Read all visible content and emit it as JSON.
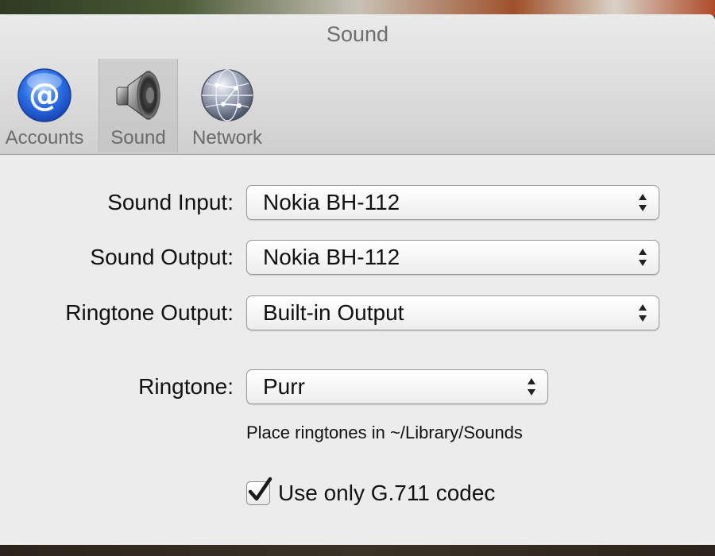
{
  "window": {
    "title": "Sound"
  },
  "toolbar": {
    "items": [
      {
        "label": "Accounts",
        "icon": "at-sign-icon",
        "selected": false
      },
      {
        "label": "Sound",
        "icon": "speaker-icon",
        "selected": true
      },
      {
        "label": "Network",
        "icon": "globe-icon",
        "selected": false
      }
    ]
  },
  "form": {
    "sound_input": {
      "label": "Sound Input:",
      "value": "Nokia BH-112"
    },
    "sound_output": {
      "label": "Sound Output:",
      "value": "Nokia BH-112"
    },
    "ringtone_output": {
      "label": "Ringtone Output:",
      "value": "Built-in Output"
    },
    "ringtone": {
      "label": "Ringtone:",
      "value": "Purr"
    },
    "ringtone_hint": "Place ringtones in ~/Library/Sounds",
    "codec_checkbox": {
      "label": "Use only G.711 codec",
      "checked": true
    }
  },
  "colors": {
    "accounts_icon_blue": "#2b6fe8",
    "window_background": "#ececec",
    "title_text": "#6e6e6e"
  }
}
